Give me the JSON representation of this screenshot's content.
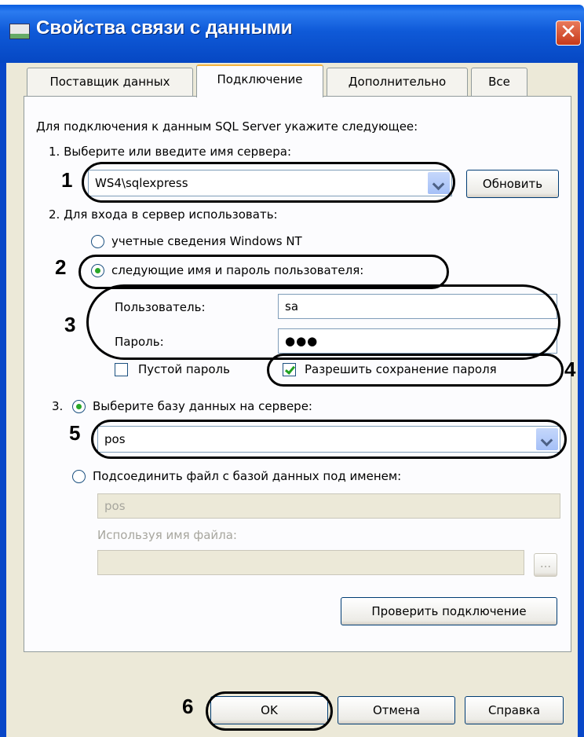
{
  "window": {
    "title": "Свойства связи с данными",
    "close_glyph": "✕"
  },
  "tabs": [
    "Поставщик данных",
    "Подключение",
    "Дополнительно",
    "Все"
  ],
  "section_intro": "Для подключения к данным SQL Server укажите следующее:",
  "step1": {
    "label": "1. Выберите или введите имя сервера:",
    "server_value": "WS4\\sqlexpress",
    "refresh_button": "Обновить"
  },
  "step2": {
    "label": "2. Для входа в сервер использовать:",
    "radio_windows": "учетные сведения Windows NT",
    "radio_sql": "следующие имя и пароль пользователя:",
    "user_label": "Пользователь:",
    "user_value": "sa",
    "password_label": "Пароль:",
    "password_value": "●●●",
    "blank_password": "Пустой пароль",
    "allow_save": "Разрешить сохранение пароля"
  },
  "step3": {
    "prefix": "3.",
    "radio_db": "Выберите базу данных на сервере:",
    "db_value": "pos",
    "radio_attach": "Подсоединить файл с базой данных под именем:",
    "attach_value": "pos",
    "filename_label": "Используя имя файла:",
    "filename_value": "",
    "browse_label": "...",
    "test_button": "Проверить подключение"
  },
  "footer": {
    "ok": "OK",
    "cancel": "Отмена",
    "help": "Справка"
  },
  "annotations": [
    "1",
    "2",
    "3",
    "4",
    "5",
    "6"
  ],
  "colors": {
    "titlebar": "#0a5ee0",
    "client": "#ece9d8",
    "radio_dot": "#28a728"
  }
}
